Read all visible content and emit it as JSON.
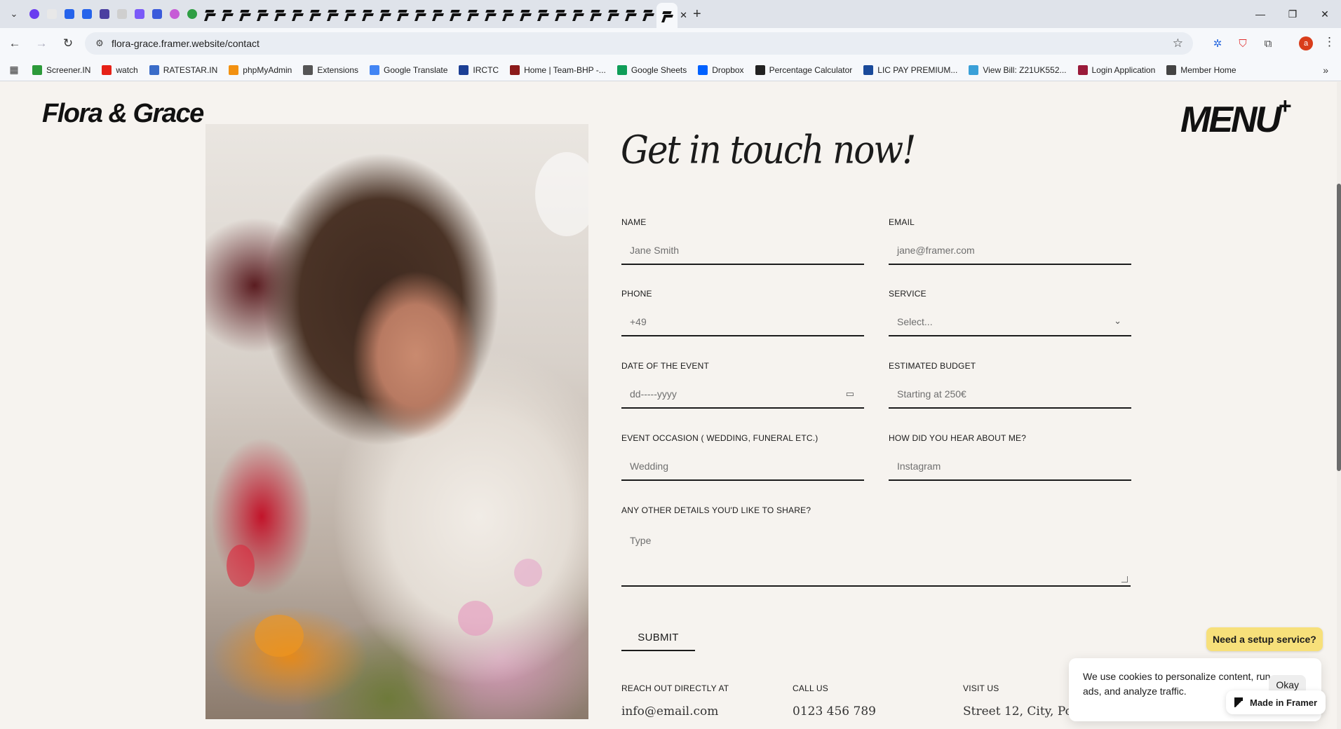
{
  "browser": {
    "active_tab_close": "✕",
    "new_tab": "+",
    "window_controls": {
      "minimize": "—",
      "restore": "❐",
      "close": "✕"
    },
    "url": "flora-grace.framer.website/contact",
    "profile_initial": "a",
    "bookmarks": [
      {
        "label": "Screener.IN",
        "color": "#2c9a3a"
      },
      {
        "label": "watch",
        "color": "#e62117"
      },
      {
        "label": "RATESTAR.IN",
        "color": "#3a6cc8"
      },
      {
        "label": "phpMyAdmin",
        "color": "#f29111"
      },
      {
        "label": "Extensions",
        "color": "#555555"
      },
      {
        "label": "Google Translate",
        "color": "#4285f4"
      },
      {
        "label": "IRCTC",
        "color": "#1c3f95"
      },
      {
        "label": "Home | Team-BHP -...",
        "color": "#8b1a1a"
      },
      {
        "label": "Google Sheets",
        "color": "#0f9d58"
      },
      {
        "label": "Dropbox",
        "color": "#0061ff"
      },
      {
        "label": "Percentage Calculator",
        "color": "#222222"
      },
      {
        "label": "LIC PAY PREMIUM...",
        "color": "#1a4a9a"
      },
      {
        "label": "View Bill: Z21UK552...",
        "color": "#3aa0d8"
      },
      {
        "label": "Login Application",
        "color": "#9a1a3a"
      },
      {
        "label": "Member Home",
        "color": "#444444"
      }
    ]
  },
  "site": {
    "brand": "Flora & Grace",
    "menu_label": "MENU",
    "menu_plus": "+"
  },
  "form": {
    "headline": "Get in touch now!",
    "fields": {
      "name": {
        "label": "NAME",
        "placeholder": "Jane Smith"
      },
      "email": {
        "label": "EMAIL",
        "placeholder": "jane@framer.com"
      },
      "phone": {
        "label": "PHONE",
        "placeholder": "+49"
      },
      "service": {
        "label": "SERVICE",
        "value": "Select..."
      },
      "date": {
        "label": "DATE OF THE EVENT",
        "placeholder": "dd-----yyyy"
      },
      "budget": {
        "label": "ESTIMATED BUDGET",
        "placeholder": "Starting at 250€"
      },
      "occasion": {
        "label": "EVENT OCCASION ( WEDDING, FUNERAL ETC.)",
        "placeholder": "Wedding"
      },
      "source": {
        "label": "HOW DID YOU HEAR ABOUT ME?",
        "placeholder": "Instagram"
      },
      "details": {
        "label": "ANY OTHER DETAILS YOU'D LIKE TO SHARE?",
        "placeholder": "Type"
      }
    },
    "submit_label": "SUBMIT"
  },
  "contact": {
    "email": {
      "label": "REACH OUT DIRECTLY AT",
      "value": "info@email.com"
    },
    "phone": {
      "label": "CALL US",
      "value": "0123 456 789"
    },
    "address": {
      "label": "VISIT US",
      "value": "Street 12, City, Postal Code"
    }
  },
  "overlays": {
    "setup_button": "Need a setup service?",
    "cookie_text": "We use cookies to personalize content, run ads, and analyze traffic.",
    "cookie_ok": "Okay",
    "framer_badge": "Made in Framer"
  }
}
